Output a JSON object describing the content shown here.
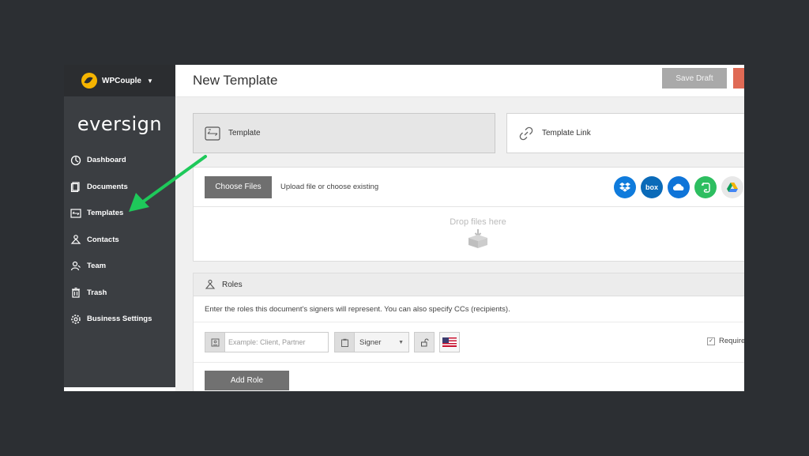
{
  "account": {
    "name": "WPCouple"
  },
  "brand": {
    "name": "eversign"
  },
  "sidebar": {
    "items": [
      {
        "label": "Dashboard",
        "icon": "dashboard-icon"
      },
      {
        "label": "Documents",
        "icon": "documents-icon"
      },
      {
        "label": "Templates",
        "icon": "templates-icon"
      },
      {
        "label": "Contacts",
        "icon": "contacts-icon"
      },
      {
        "label": "Team",
        "icon": "team-icon"
      },
      {
        "label": "Trash",
        "icon": "trash-icon"
      },
      {
        "label": "Business Settings",
        "icon": "gear-icon"
      }
    ]
  },
  "header": {
    "title": "New Template",
    "save_draft": "Save Draft"
  },
  "types": {
    "template": "Template",
    "template_link": "Template Link"
  },
  "upload": {
    "choose_files": "Choose Files",
    "hint": "Upload file or choose existing",
    "drop_text": "Drop files here",
    "providers": [
      {
        "name": "dropbox-icon",
        "color": "#0f7bdc"
      },
      {
        "name": "box-icon",
        "color": "#0a6ab8",
        "label": "box"
      },
      {
        "name": "onedrive-icon",
        "color": "#0f74d8"
      },
      {
        "name": "evernote-icon",
        "color": "#2dbe60"
      },
      {
        "name": "google-drive-icon",
        "color": "#e8e8e8"
      }
    ]
  },
  "roles": {
    "title": "Roles",
    "description": "Enter the roles this document's signers will represent. You can also specify CCs (recipients).",
    "role_placeholder": "Example: Client, Partner",
    "signer_type": "Signer",
    "required_label": "Require",
    "add_role": "Add Role"
  },
  "colors": {
    "accent_arrow": "#1ec95a",
    "sidebar": "#3b3e42"
  }
}
